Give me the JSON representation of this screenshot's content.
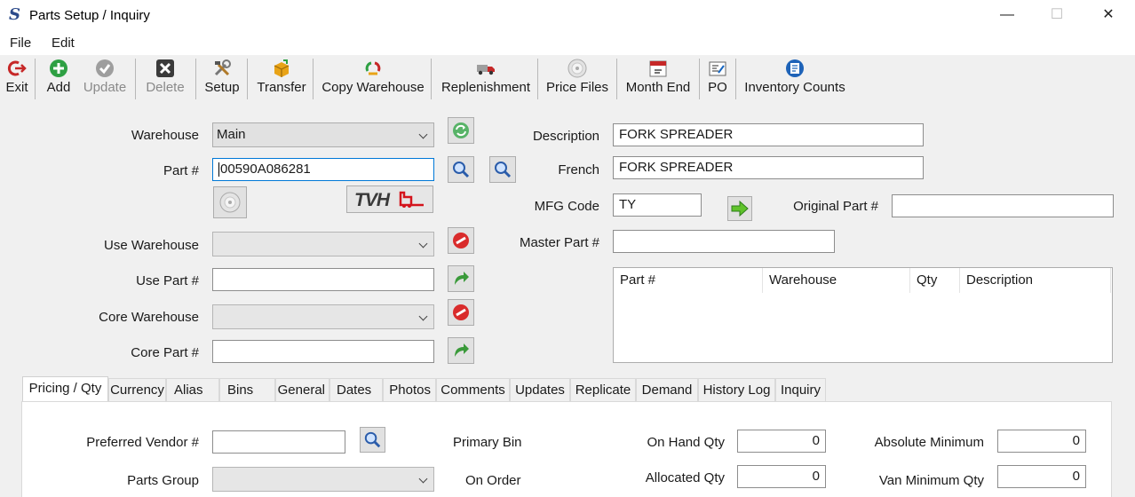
{
  "window": {
    "title": "Parts Setup / Inquiry",
    "minimize": "—",
    "maximize": "☐",
    "close": "✕"
  },
  "menu": {
    "file": "File",
    "edit": "Edit"
  },
  "toolbar": {
    "exit": "Exit",
    "add": "Add",
    "update": "Update",
    "delete": "Delete",
    "setup": "Setup",
    "transfer": "Transfer",
    "copy_warehouse": "Copy Warehouse",
    "replenishment": "Replenishment",
    "price_files": "Price Files",
    "month_end": "Month End",
    "po": "PO",
    "inventory_counts": "Inventory Counts"
  },
  "form": {
    "warehouse_label": "Warehouse",
    "warehouse_value": "Main",
    "part_label": "Part #",
    "part_value": "00590A086281",
    "vendor_logo": "TVH",
    "use_warehouse_label": "Use Warehouse",
    "use_part_label": "Use Part #",
    "core_warehouse_label": "Core Warehouse",
    "core_part_label": "Core Part #",
    "description_label": "Description",
    "description_value": "FORK SPREADER",
    "french_label": "French",
    "french_value": "FORK SPREADER",
    "mfg_code_label": "MFG Code",
    "mfg_code_value": "TY",
    "original_part_label": "Original Part #",
    "master_part_label": "Master Part #"
  },
  "grid": {
    "columns": [
      "Part #",
      "Warehouse",
      "Qty",
      "Description"
    ]
  },
  "tabs": [
    "Pricing / Qty",
    "Currency",
    "Alias",
    "Bins",
    "General",
    "Dates",
    "Photos",
    "Comments",
    "Updates",
    "Replicate",
    "Demand",
    "History Log",
    "Inquiry"
  ],
  "pricing": {
    "preferred_vendor_label": "Preferred Vendor #",
    "parts_group_label": "Parts Group",
    "primary_bin_label": "Primary Bin",
    "on_order_label": "On Order",
    "on_hand_label": "On Hand Qty",
    "on_hand_value": "0",
    "allocated_label": "Allocated Qty",
    "allocated_value": "0",
    "absolute_min_label": "Absolute Minimum",
    "absolute_min_value": "0",
    "van_min_label": "Van Minimum Qty",
    "van_min_value": "0"
  },
  "colors": {
    "accent_blue": "#0078d7",
    "green": "#2ea043",
    "red": "#d92b2b",
    "tvh_red": "#d4141c"
  }
}
